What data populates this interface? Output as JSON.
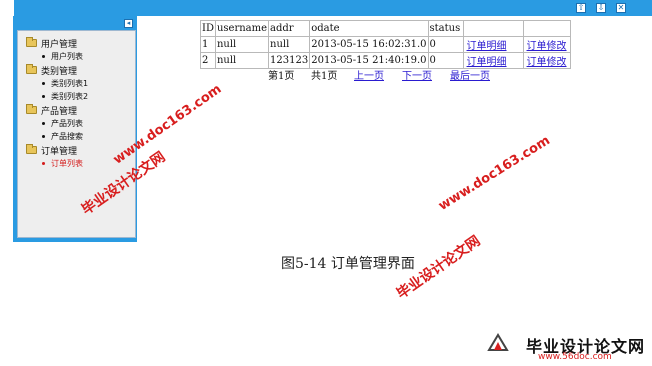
{
  "toolbar": {
    "icons": [
      "up-arrow-icon",
      "download-icon",
      "close-icon"
    ],
    "glyphs": [
      "⇧",
      "⇩",
      "✕"
    ]
  },
  "sidebar": {
    "collapse_glyph": "◂",
    "groups": [
      {
        "label": "用户管理",
        "items": [
          {
            "label": "用户列表",
            "active": false
          }
        ]
      },
      {
        "label": "类别管理",
        "items": [
          {
            "label": "类别列表1",
            "active": false
          },
          {
            "label": "类别列表2",
            "active": false
          }
        ]
      },
      {
        "label": "产品管理",
        "items": [
          {
            "label": "产品列表",
            "active": false
          },
          {
            "label": "产品搜索",
            "active": false
          }
        ]
      },
      {
        "label": "订单管理",
        "items": [
          {
            "label": "订单列表",
            "active": true
          }
        ]
      }
    ]
  },
  "table": {
    "headers": [
      "ID",
      "username",
      "addr",
      "odate",
      "status",
      "",
      ""
    ],
    "rows": [
      [
        "1",
        "null",
        "null",
        "2013-05-15 16:02:31.0",
        "0",
        "订单明细",
        "订单修改"
      ],
      [
        "2",
        "null",
        "123123",
        "2013-05-15 21:40:19.0",
        "0",
        "订单明细",
        "订单修改"
      ]
    ]
  },
  "pagination": {
    "current": "第1页",
    "total": "共1页",
    "prev": "上一页",
    "next": "下一页",
    "last": "最后一页"
  },
  "caption": "图5-14 订单管理界面",
  "watermarks": {
    "url": "www.doc163.com",
    "cn": "毕业设计论文网"
  },
  "footer": {
    "title": "毕业设计论文网",
    "url": "www.56doc.com"
  },
  "colors": {
    "frame_blue": "#2a9be2",
    "link_blue": "#2a1bd0",
    "active_red": "#d41c1c",
    "watermark_red": "#d81e1e"
  }
}
